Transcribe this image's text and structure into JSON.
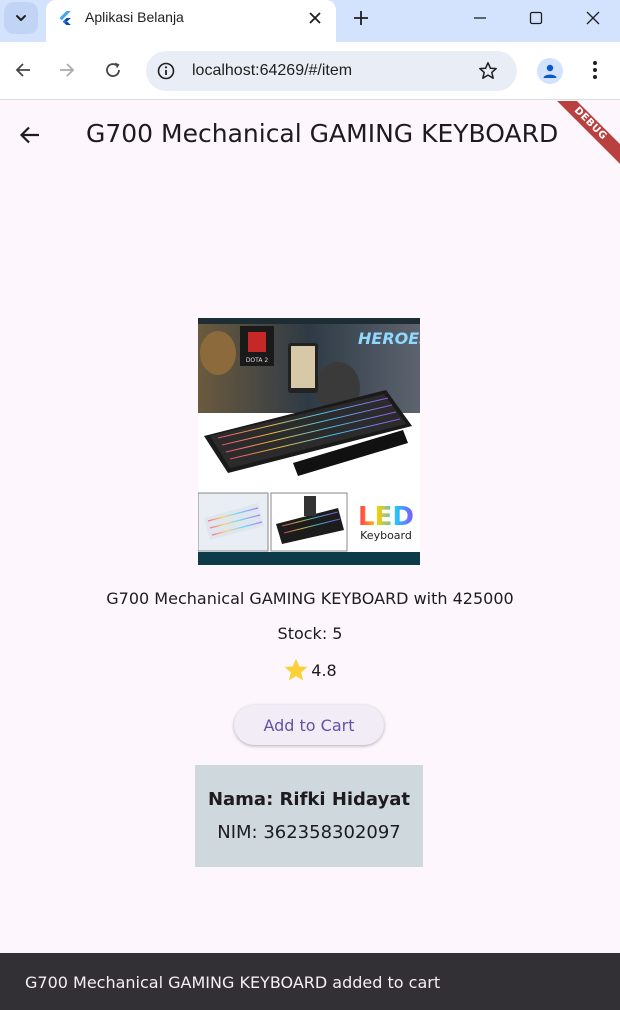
{
  "browser": {
    "tab_title": "Aplikasi Belanja",
    "url": "localhost:64269/#/item"
  },
  "app": {
    "title": "G700 Mechanical GAMING KEYBOARD",
    "debug_label": "DEBUG",
    "product": {
      "image_alt": "G700 Mechanical GAMING KEYBOARD",
      "image_text": {
        "brand1": "DOTA 2",
        "brand2": "HEROES",
        "led": "LED",
        "keyboard": "Keyboard"
      },
      "description": "G700 Mechanical GAMING KEYBOARD with 425000",
      "stock": "Stock: 5",
      "rating": "4.8",
      "add_to_cart_label": "Add to Cart"
    },
    "identity": {
      "nama": "Nama: Rifki Hidayat",
      "nim": "NIM: 362358302097"
    },
    "snackbar": "G700 Mechanical GAMING KEYBOARD added to cart"
  },
  "colors": {
    "accent": "#6750a4",
    "background": "#fdf6fd",
    "identity_box": "#cfd8dc",
    "snackbar": "#322f35",
    "star": "#fbd13a",
    "debug_ribbon": "#b8403f"
  }
}
